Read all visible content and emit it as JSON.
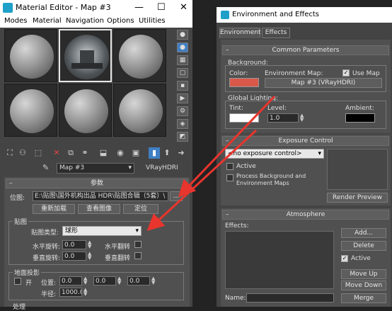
{
  "material_editor": {
    "title": "Material Editor - Map #3",
    "window_controls": [
      "—",
      "☐",
      "✕"
    ],
    "menu": [
      "Modes",
      "Material",
      "Navigation",
      "Options",
      "Utilities"
    ],
    "map_name": "Map #3",
    "map_type": "VRayHDRI",
    "rollout_title": "参数",
    "location_label": "位图:",
    "file_path": "E:\\贴图\\国外机构出品 HDR\\贴图合辑（5套）\\",
    "browse_button": "...",
    "reload_button": "重新加载",
    "view_image_button": "查看图像",
    "locate_button": "定位",
    "mapping_group": "贴图",
    "map_type_label": "贴图类型:",
    "map_type_value": "球形",
    "h_rotation_label": "水平旋转:",
    "h_rotation_value": "0.0",
    "h_flip_label": "水平翻转",
    "v_rotation_label": "垂直旋转:",
    "v_rotation_value": "0.0",
    "v_flip_label": "垂直翻转",
    "ground_projection_group": "地面投影",
    "on_label": "开",
    "position_label": "位置:",
    "position_values": [
      "0.0",
      "0.0",
      "0.0"
    ],
    "radius_label": "半径:",
    "radius_value": "1000.0",
    "processing_group": "处理"
  },
  "environment": {
    "title": "Environment and Effects",
    "tabs": [
      "Environment",
      "Effects"
    ],
    "common_parameters": "Common Parameters",
    "background_group": "Background:",
    "color_label": "Color:",
    "background_color": "#d9584a",
    "environment_map_label": "Environment Map:",
    "use_map_label": "Use Map",
    "env_map_button": "Map #3 (VRayHDRI)",
    "global_lighting_group": "Global Lighting:",
    "tint_label": "Tint:",
    "tint_color": "#ffffff",
    "level_label": "Level:",
    "level_value": "1.0",
    "ambient_label": "Ambient:",
    "ambient_color": "#000000",
    "exposure_control": "Exposure Control",
    "exposure_dropdown": "<no exposure control>",
    "active_label": "Active",
    "process_bg_label": "Process Background and Environment Maps",
    "render_preview_button": "Render Preview",
    "atmosphere": "Atmosphere",
    "effects_label": "Effects:",
    "add_button": "Add...",
    "delete_button": "Delete",
    "atm_active_label": "Active",
    "move_up_button": "Move Up",
    "move_down_button": "Move Down",
    "name_label": "Name:",
    "merge_button": "Merge"
  },
  "colors": {
    "arrow": "#e8352d",
    "accent": "#3f7fc4"
  }
}
